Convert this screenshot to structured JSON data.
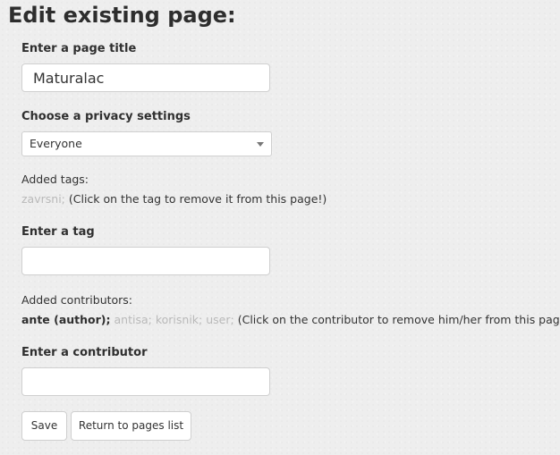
{
  "page_title": "Edit existing page:",
  "title_field": {
    "label": "Enter a page title",
    "value": "Maturalac"
  },
  "privacy": {
    "label": "Choose a privacy settings",
    "selected": "Everyone"
  },
  "tags": {
    "label": "Added tags:",
    "items": [
      "zavrsni;"
    ],
    "hint": "(Click on the tag to remove it from this page!)"
  },
  "tag_field": {
    "label": "Enter a tag",
    "value": "",
    "placeholder": ""
  },
  "contributors": {
    "label": "Added contributors:",
    "author": "ante (author);",
    "items": [
      "antisa;",
      "korisnik;",
      "user;"
    ],
    "hint": "(Click on the contributor to remove him/her from this page!)"
  },
  "contributor_field": {
    "label": "Enter a contributor",
    "value": "",
    "placeholder": ""
  },
  "buttons": {
    "save": "Save",
    "return": "Return to pages list"
  },
  "colors": {
    "background": "#eeeeee",
    "muted_chip": "#b9b9b9",
    "text": "#333333"
  }
}
